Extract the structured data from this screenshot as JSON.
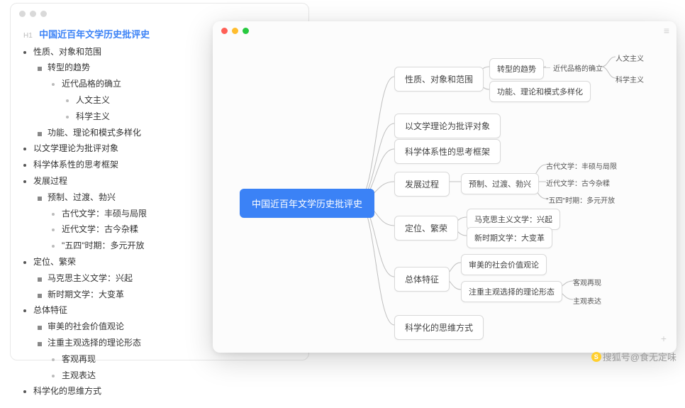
{
  "outline": {
    "heading_label": "H1",
    "title": "中国近百年文学历史批评史",
    "tree": {
      "n1": {
        "t": "性质、对象和范围"
      },
      "n1_1": {
        "t": "转型的趋势"
      },
      "n1_1_1": {
        "t": "近代品格的确立"
      },
      "n1_1_1_1": {
        "t": "人文主义"
      },
      "n1_1_1_2": {
        "t": "科学主义"
      },
      "n1_2": {
        "t": "功能、理论和模式多样化"
      },
      "n2": {
        "t": "以文学理论为批评对象"
      },
      "n3": {
        "t": "科学体系性的思考框架"
      },
      "n4": {
        "t": "发展过程"
      },
      "n4_1": {
        "t": "预制、过渡、勃兴"
      },
      "n4_1_1": {
        "t": "古代文学：丰硕与局限"
      },
      "n4_1_2": {
        "t": "近代文学：古今杂糅"
      },
      "n4_1_3": {
        "t": "\"五四\"时期：多元开放"
      },
      "n5": {
        "t": "定位、繁荣"
      },
      "n5_1": {
        "t": "马克思主义文学：兴起"
      },
      "n5_2": {
        "t": "新时期文学：大变革"
      },
      "n6": {
        "t": "总体特征"
      },
      "n6_1": {
        "t": "审美的社会价值观论"
      },
      "n6_2": {
        "t": "注重主观选择的理论形态"
      },
      "n6_2_1": {
        "t": "客观再现"
      },
      "n6_2_2": {
        "t": "主观表达"
      },
      "n7": {
        "t": "科学化的思维方式"
      }
    }
  },
  "mindmap": {
    "root": "中国近百年文学历史批评史",
    "b1": "性质、对象和范围",
    "b1a": "转型的趋势",
    "b1a_x": "近代品格的确立",
    "b1a_1": "人文主义",
    "b1a_2": "科学主义",
    "b1b": "功能、理论和模式多样化",
    "b2": "以文学理论为批评对象",
    "b3": "科学体系性的思考框架",
    "b4": "发展过程",
    "b4a": "预制、过渡、勃兴",
    "b4a_1": "古代文学：丰硕与局限",
    "b4a_2": "近代文学：古今杂糅",
    "b4a_3": "\"五四\"时期：多元开放",
    "b5": "定位、繁荣",
    "b5_1": "马克思主义文学：兴起",
    "b5_2": "新时期文学：大变革",
    "b6": "总体特征",
    "b6_1": "审美的社会价值观论",
    "b6_2": "注重主观选择的理论形态",
    "b6_2_1": "客观再现",
    "b6_2_2": "主观表达",
    "b7": "科学化的思维方式"
  },
  "watermark": "搜狐号@食无定味"
}
